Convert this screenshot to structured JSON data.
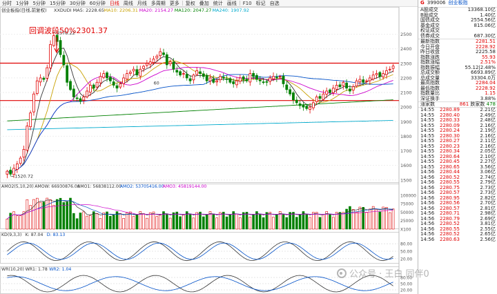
{
  "toolbar": {
    "tabs": [
      {
        "label": "分时",
        "active": false
      },
      {
        "label": "1分钟",
        "active": false
      },
      {
        "label": "5分钟",
        "active": false
      },
      {
        "label": "15分钟",
        "active": false
      },
      {
        "label": "30分钟",
        "active": false
      },
      {
        "label": "60分钟",
        "active": false
      },
      {
        "label": "日线",
        "active": true
      },
      {
        "label": "周线",
        "active": false
      },
      {
        "label": "月线",
        "active": false
      },
      {
        "label": "多周期",
        "active": false
      },
      {
        "label": "更多",
        "active": false
      },
      {
        "label": "复权",
        "active": false
      },
      {
        "label": "叠加",
        "active": false
      },
      {
        "label": "统计",
        "active": false
      },
      {
        "label": "画线",
        "active": false
      },
      {
        "label": "F10",
        "active": false
      },
      {
        "label": "标记",
        "active": false
      },
      {
        "label": "自选",
        "active": false
      }
    ],
    "right_tabs": [
      "多周期",
      "更多"
    ]
  },
  "chart_header": {
    "title": "创业板指(日线,前复权)",
    "ma_labels": [
      {
        "text": "XXDUDI MA5: 2228.65",
        "color": "#333333"
      },
      {
        "text": "MA10: 2206.31",
        "color": "#c8a000"
      },
      {
        "text": "MA20: 2154.27",
        "color": "#cc00cc"
      },
      {
        "text": "MA120: 2047.27",
        "color": "#008000"
      },
      {
        "text": "MA240: 1907.92",
        "color": "#00aacc"
      }
    ]
  },
  "annotations": {
    "top_price": "2578.22",
    "low_price": "1520.72",
    "retracement": "回调波段50%2301.37",
    "marker_60": "60"
  },
  "indicator_headers": {
    "amo": [
      {
        "text": "AMO2(5,10,20)",
        "color": "#333333"
      },
      {
        "text": "AMOW: 66930876.00",
        "color": "#333333"
      },
      {
        "text": "AMO1: 56838112.00",
        "color": "#333333"
      },
      {
        "text": "AMO2: 53705416.00",
        "color": "#0050c8"
      },
      {
        "text": "AMO3: 45819144.00",
        "color": "#cc00cc"
      }
    ],
    "kd": [
      {
        "text": "KD(9,3,3)",
        "color": "#333333"
      },
      {
        "text": "K: 87.04",
        "color": "#333333"
      },
      {
        "text": "D: 83.13",
        "color": "#0050c8"
      }
    ],
    "wr": [
      {
        "text": "WR(10,20)",
        "color": "#333333"
      },
      {
        "text": "WR1: 1.78",
        "color": "#333333"
      },
      {
        "text": "WR2: 1.04",
        "color": "#0050c8"
      }
    ]
  },
  "price_axis": {
    "labels": [
      "2500",
      "2400",
      "2300",
      "2200",
      "2100",
      "2000",
      "1900",
      "1800",
      "1700",
      "1600",
      "1500"
    ],
    "min": 1480,
    "max": 2640,
    "amo_labels": [
      "100000",
      "75000",
      "50000",
      "25000",
      "X100"
    ],
    "amo_max": 110000,
    "kd_labels": [
      "80.00",
      "50.00",
      "20.00"
    ],
    "wr_labels": [
      "80.00",
      "50.00",
      "20.00"
    ]
  },
  "colors": {
    "up": "#e00000",
    "down": "#008000",
    "hline": "#e00000",
    "ma5": "#333333",
    "ma10": "#c8a000",
    "ma20": "#cc00cc",
    "ma60": "#0050c8",
    "ma120": "#008000",
    "ma240": "#00aacc"
  },
  "chart_data": {
    "type": "candlestick",
    "hlines": [
      2301.37,
      2045
    ],
    "kline_closes": [
      1560,
      1540,
      1580,
      1610,
      1650,
      1710,
      1870,
      1960,
      2090,
      2180,
      2200,
      2190,
      2270,
      2430,
      2490,
      2450,
      2360,
      2290,
      2170,
      2120,
      2070,
      2060,
      2040,
      2070,
      2110,
      2150,
      2130,
      2170,
      2210,
      2230,
      2200,
      2180,
      2150,
      2130,
      2160,
      2200,
      2230,
      2240,
      2260,
      2220,
      2260,
      2280,
      2300,
      2310,
      2330,
      2350,
      2380,
      2360,
      2290,
      2310,
      2260,
      2240,
      2220,
      2230,
      2200,
      2180,
      2220,
      2250,
      2230,
      2210,
      2180,
      2200,
      2170,
      2180,
      2210,
      2200,
      2190,
      2170,
      2160,
      2180,
      2200,
      2190,
      2180,
      2230,
      2210,
      2190,
      2180,
      2170,
      2170,
      2200,
      2210,
      2200,
      2210,
      2160,
      2120,
      2090,
      2050,
      2030,
      2010,
      2000,
      1990,
      2000,
      2030,
      2070,
      2060,
      2090,
      2110,
      2100,
      2130,
      2150,
      2140,
      2170,
      2130,
      2110,
      2140,
      2180,
      2190,
      2170,
      2180,
      2200,
      2220,
      2230,
      2210,
      2230,
      2250,
      2260,
      2281.51
    ]
  },
  "right_panel": {
    "header": {
      "flag": "G",
      "code": "399006",
      "name": "创业板指"
    },
    "info_rows": [
      {
        "label": "A股成交",
        "value": "13368.10亿",
        "color": ""
      },
      {
        "label": "B股成交",
        "value": "1.40亿",
        "color": ""
      },
      {
        "label": "国债成交",
        "value": "2554.56亿",
        "color": ""
      },
      {
        "label": "基金成交",
        "value": "815.06亿",
        "color": ""
      },
      {
        "label": "权证成交",
        "value": "",
        "color": ""
      },
      {
        "label": "债券成交",
        "value": "687.30亿",
        "color": ""
      }
    ],
    "quote_rows": [
      {
        "label": "最新指数",
        "value": "2281.51",
        "color": "red"
      },
      {
        "label": "今日开盘",
        "value": "2228.92",
        "color": "red"
      },
      {
        "label": "昨日收盘",
        "value": "2225.58",
        "color": ""
      },
      {
        "label": "指数涨跌",
        "value": "55.93",
        "color": "red"
      },
      {
        "label": "指数涨幅",
        "value": "2.51%",
        "color": "red"
      },
      {
        "label": "指数振幅",
        "value": "55.12|2.48%",
        "color": ""
      },
      {
        "label": "总成交额",
        "value": "6693.89亿",
        "color": ""
      },
      {
        "label": "总成交量",
        "value": "33304.0万",
        "color": ""
      },
      {
        "label": "最高指数",
        "value": "2284.04",
        "color": "red"
      },
      {
        "label": "最低指数",
        "value": "2228.92",
        "color": "red"
      },
      {
        "label": "指数量比",
        "value": "1.15",
        "color": "red"
      },
      {
        "label": "深证换手",
        "value": "3.88%",
        "color": ""
      }
    ],
    "ticks_header": {
      "label": "涨家数",
      "up": "861",
      "down_label": "跌家数",
      "down": "478"
    },
    "ticks": [
      {
        "time": "14:55",
        "price": "2280.89",
        "amt": "2.21亿"
      },
      {
        "time": "14:55",
        "price": "2280.40",
        "amt": "2.49亿"
      },
      {
        "time": "14:55",
        "price": "2280.33",
        "amt": "2.48亿"
      },
      {
        "time": "14:55",
        "price": "2280.09",
        "amt": "2.16亿"
      },
      {
        "time": "14:55",
        "price": "2280.24",
        "amt": "2.19亿"
      },
      {
        "time": "14:55",
        "price": "2280.30",
        "amt": "2.16亿"
      },
      {
        "time": "14:55",
        "price": "2280.27",
        "amt": "2.11亿"
      },
      {
        "time": "14:55",
        "price": "2280.23",
        "amt": "2.16亿"
      },
      {
        "time": "14:55",
        "price": "2280.34",
        "amt": "2.05亿"
      },
      {
        "time": "14:55",
        "price": "2280.64",
        "amt": "2.10亿"
      },
      {
        "time": "14:55",
        "price": "2280.45",
        "amt": "2.27亿"
      },
      {
        "time": "14:55",
        "price": "2280.65",
        "amt": "3.56亿"
      },
      {
        "time": "14:56",
        "price": "2280.44",
        "amt": "3.06亿"
      },
      {
        "time": "14:56",
        "price": "2280.52",
        "amt": "2.74亿"
      },
      {
        "time": "14:56",
        "price": "2280.55",
        "amt": "2.79亿"
      },
      {
        "time": "14:56",
        "price": "2280.75",
        "amt": "2.73亿"
      },
      {
        "time": "14:56",
        "price": "2280.57",
        "amt": "2.73亿"
      },
      {
        "time": "14:56",
        "price": "2280.95",
        "amt": "2.82亿"
      },
      {
        "time": "14:56",
        "price": "2280.56",
        "amt": "2.70亿"
      },
      {
        "time": "14:56",
        "price": "2280.57",
        "amt": "2.81亿"
      },
      {
        "time": "14:56",
        "price": "2280.71",
        "amt": "2.98亿"
      },
      {
        "time": "14:56",
        "price": "2280.79",
        "amt": "2.69亿"
      },
      {
        "time": "14:56",
        "price": "2280.52",
        "amt": "3.81亿"
      },
      {
        "time": "14:56",
        "price": "2280.55",
        "amt": "2.55亿"
      },
      {
        "time": "14:56",
        "price": "2280.52",
        "amt": "2.65亿"
      },
      {
        "time": "14:56",
        "price": "2280.63",
        "amt": "2.56亿"
      }
    ]
  },
  "watermark": {
    "text": "公众号 · 王白 同伴0"
  }
}
